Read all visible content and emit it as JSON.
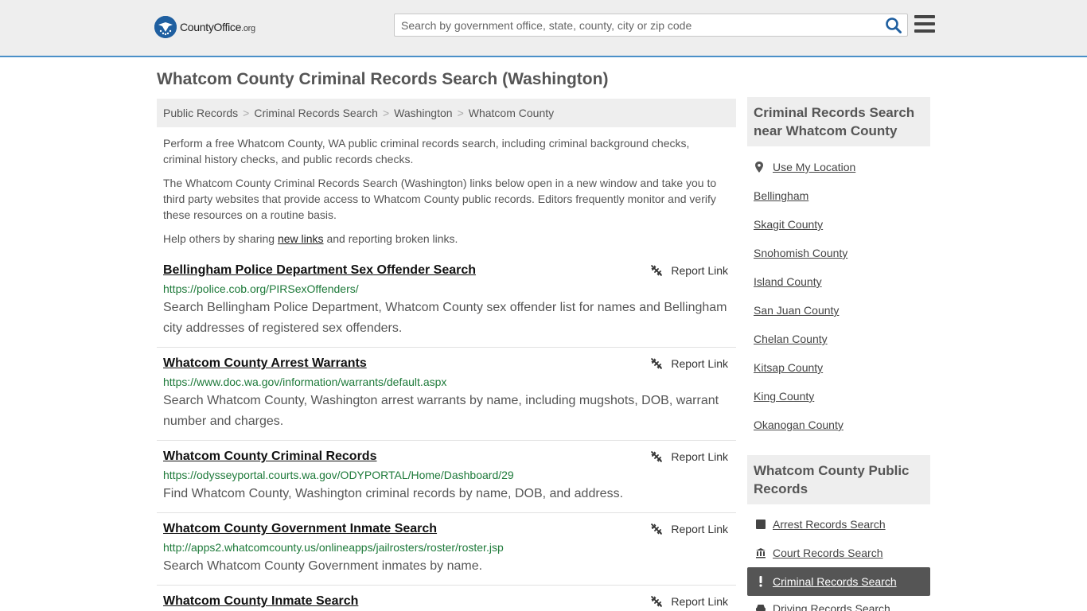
{
  "header": {
    "logo_main": "CountyOffice",
    "logo_tld": ".org",
    "search_placeholder": "Search by government office, state, county, city or zip code"
  },
  "page_title": "Whatcom County Criminal Records Search (Washington)",
  "breadcrumb": [
    "Public Records",
    "Criminal Records Search",
    "Washington",
    "Whatcom County"
  ],
  "intro": {
    "p1": "Perform a free Whatcom County, WA public criminal records search, including criminal background checks, criminal history checks, and public records checks.",
    "p2": "The Whatcom County Criminal Records Search (Washington) links below open in a new window and take you to third party websites that provide access to Whatcom County public records. Editors frequently monitor and verify these resources on a routine basis.",
    "p3_before": "Help others by sharing ",
    "p3_link": "new links",
    "p3_after": " and reporting broken links."
  },
  "report_label": "Report Link",
  "results": [
    {
      "title": "Bellingham Police Department Sex Offender Search",
      "url": "https://police.cob.org/PIRSexOffenders/",
      "desc": "Search Bellingham Police Department, Whatcom County sex offender list for names and Bellingham city addresses of registered sex offenders."
    },
    {
      "title": "Whatcom County Arrest Warrants",
      "url": "https://www.doc.wa.gov/information/warrants/default.aspx",
      "desc": "Search Whatcom County, Washington arrest warrants by name, including mugshots, DOB, warrant number and charges."
    },
    {
      "title": "Whatcom County Criminal Records",
      "url": "https://odysseyportal.courts.wa.gov/ODYPORTAL/Home/Dashboard/29",
      "desc": "Find Whatcom County, Washington criminal records by name, DOB, and address."
    },
    {
      "title": "Whatcom County Government Inmate Search",
      "url": "http://apps2.whatcomcounty.us/onlineapps/jailrosters/roster/roster.jsp",
      "desc": "Search Whatcom County Government inmates by name."
    },
    {
      "title": "Whatcom County Inmate Search",
      "url": "",
      "desc": ""
    }
  ],
  "sidebar": {
    "nearby_title": "Criminal Records Search near Whatcom County",
    "use_location": "Use My Location",
    "nearby": [
      "Bellingham",
      "Skagit County",
      "Snohomish County",
      "Island County",
      "San Juan County",
      "Chelan County",
      "Kitsap County",
      "King County",
      "Okanogan County"
    ],
    "public_title": "Whatcom County Public Records",
    "public_items": [
      {
        "label": "Arrest Records Search",
        "icon": "square-icon"
      },
      {
        "label": "Court Records Search",
        "icon": "courthouse-icon"
      },
      {
        "label": "Criminal Records Search",
        "icon": "exclamation-icon"
      },
      {
        "label": "Driving Records Search",
        "icon": "car-icon"
      }
    ]
  }
}
